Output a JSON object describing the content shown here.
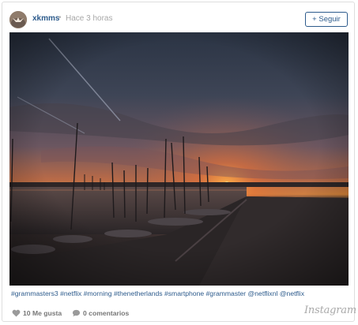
{
  "post": {
    "username": "xkmms",
    "separator": "•",
    "time_ago": "Hace 3 horas",
    "follow_label": "+ Seguir",
    "image_alt": "Sunset over a marina with sailboats",
    "hashtags": [
      "#grammasters3",
      "#netflix",
      "#morning",
      "#thenetherlands",
      "#smartphone",
      "#grammaster",
      "@netflixnl",
      "@netflix"
    ],
    "likes_label": "10 Me gusta",
    "comments_label": "0 comentarios",
    "brand": "Instagram"
  },
  "colors": {
    "link": "#2d5b8c",
    "muted": "#a8a8a8",
    "border": "#dedede"
  },
  "icons": {
    "likes": "heart-icon",
    "comments": "speech-bubble-icon"
  }
}
